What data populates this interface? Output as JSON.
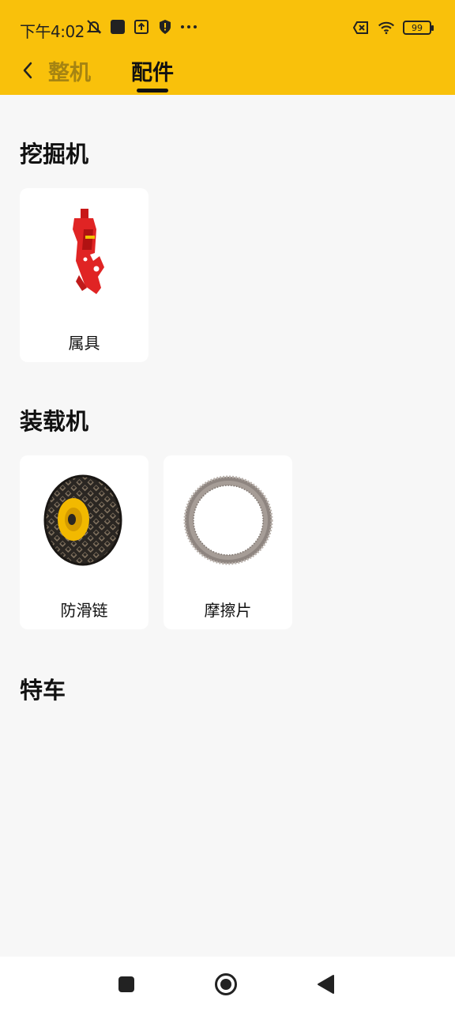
{
  "status_bar": {
    "time": "下午4:02",
    "battery": "99",
    "icons": [
      "mute-icon",
      "app-square-icon",
      "upload-icon",
      "shield-icon",
      "more-dots-icon",
      "sim-off-icon",
      "wifi-icon",
      "battery-icon"
    ]
  },
  "header": {
    "tabs": [
      {
        "label": "整机",
        "active": false
      },
      {
        "label": "配件",
        "active": true
      }
    ],
    "accent_color": "#f9c10b"
  },
  "sections": [
    {
      "title": "挖掘机",
      "items": [
        {
          "label": "属具",
          "icon": "hydraulic-crusher-image"
        }
      ]
    },
    {
      "title": "装载机",
      "items": [
        {
          "label": "防滑链",
          "icon": "tire-chain-image"
        },
        {
          "label": "摩擦片",
          "icon": "friction-disc-image"
        }
      ]
    },
    {
      "title": "特车",
      "items": []
    }
  ],
  "bottom_nav": [
    "recents-square-icon",
    "home-circle-icon",
    "back-triangle-icon"
  ]
}
